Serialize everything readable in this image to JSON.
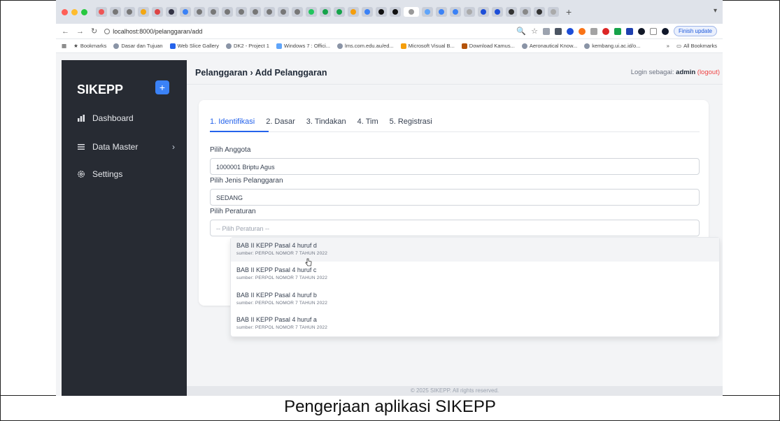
{
  "browser": {
    "url": "localhost:8000/pelanggaran/add",
    "finish_update": "Finish update",
    "bookmarks": [
      "Bookmarks",
      "Dasar dan Tujuan",
      "Web Slice Gallery",
      "DK2 - Project 1",
      "Windows 7 : Offici...",
      "lms.com.edu.au/ed...",
      "Microsoft Visual B...",
      "Download Kamus...",
      "Aeronautical Know...",
      "kembang.ui.ac.id/o..."
    ],
    "all_bookmarks": "All Bookmarks",
    "colors": {
      "tabbar": "#dfe3ea",
      "accent": "#1a56db"
    }
  },
  "sidebar": {
    "brand": "SIKEPP",
    "add_icon": "plus-icon",
    "items": [
      {
        "label": "Dashboard",
        "icon": "dashboard-icon"
      },
      {
        "label": "Data Master",
        "icon": "menu-icon",
        "has_chevron": true
      },
      {
        "label": "Settings",
        "icon": "gear-icon"
      }
    ]
  },
  "header": {
    "breadcrumb": "Pelanggaran › Add Pelanggaran",
    "login_prefix": "Login sebagai:",
    "user": "admin",
    "logout": "(logout)"
  },
  "form": {
    "tabs": [
      "1. Identifikasi",
      "2. Dasar",
      "3. Tindakan",
      "4. Tim",
      "5. Registrasi"
    ],
    "active_tab": 0,
    "anggota_label": "Pilih Anggota",
    "anggota_value": "1000001 Briptu Agus",
    "jenis_label": "Pilih Jenis Pelanggaran",
    "jenis_value": "SEDANG",
    "peraturan_label": "Pilih Peraturan",
    "peraturan_placeholder": "-- Pilih Peraturan --"
  },
  "dropdown": {
    "options": [
      {
        "title": "BAB II KEPP Pasal 4 huruf d",
        "source": "sumber: PERPOL NOMOR 7 TAHUN 2022"
      },
      {
        "title": "BAB II KEPP Pasal 4 huruf c",
        "source": "sumber: PERPOL NOMOR 7 TAHUN 2022"
      },
      {
        "title": "BAB II KEPP Pasal 4 huruf b",
        "source": "sumber: PERPOL NOMOR 7 TAHUN 2022"
      },
      {
        "title": "BAB II KEPP Pasal 4 huruf a",
        "source": "sumber: PERPOL NOMOR 7 TAHUN 2022"
      }
    ],
    "hovered_index": 0
  },
  "footer": {
    "text": "© 2025 SIKEPP. All rights reserved."
  },
  "caption": "Pengerjaan aplikasi SIKEPP"
}
